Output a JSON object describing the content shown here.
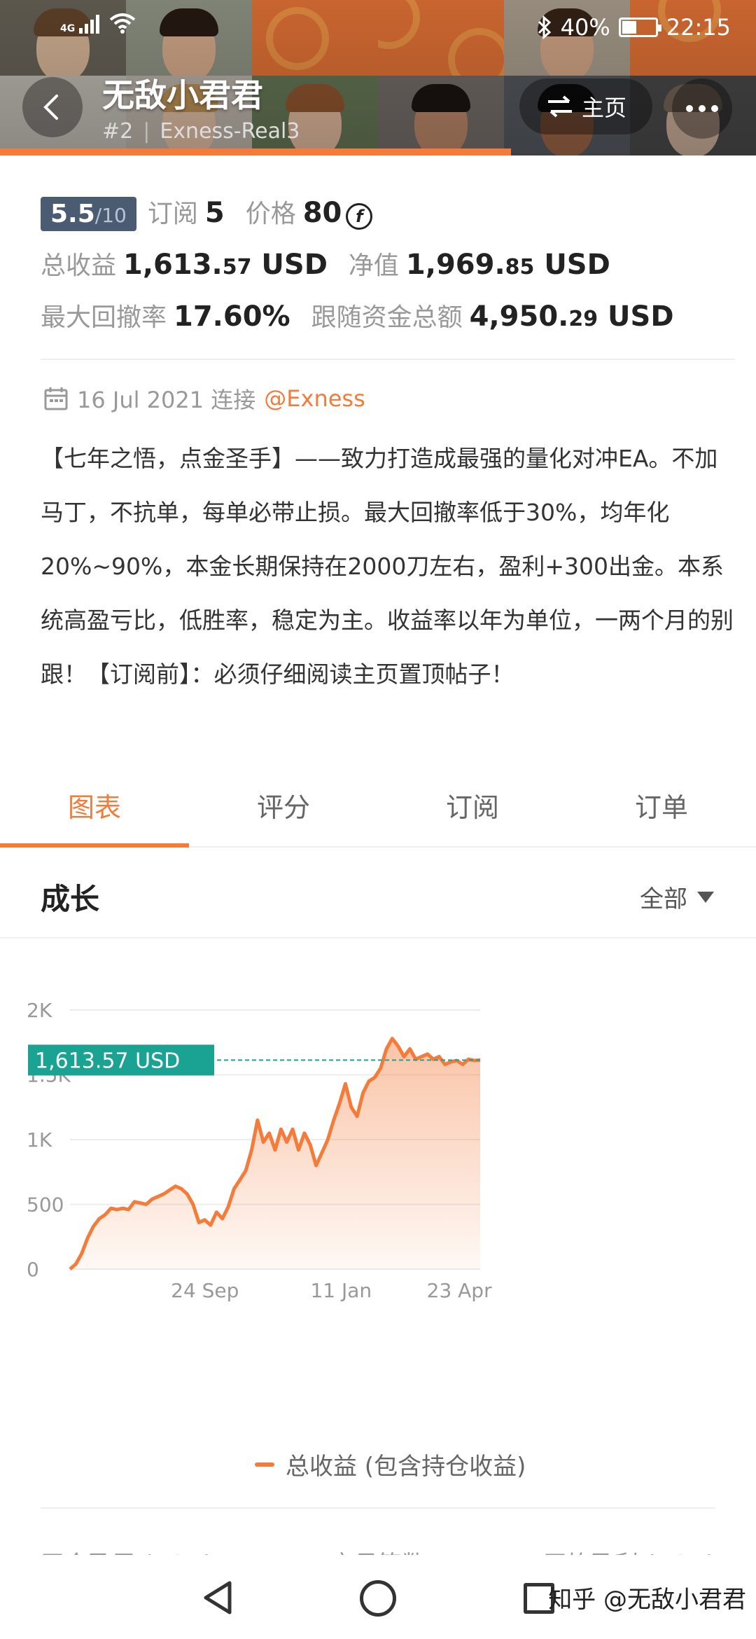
{
  "status_bar": {
    "network": "4G",
    "battery": "40%",
    "time": "22:15"
  },
  "header": {
    "name": "无敌小君君",
    "rank": "#2",
    "account": "Exness-Real3",
    "home_label": "主页"
  },
  "stats": {
    "rating_value": "5.5",
    "rating_max": "/10",
    "subscribe_label": "订阅",
    "subscribe_count": "5",
    "price_label": "价格",
    "price_value": "80",
    "total_profit_label": "总收益",
    "total_profit_main": "1,613.",
    "total_profit_dec": "57",
    "total_profit_unit": " USD",
    "equity_label": "净值",
    "equity_main": "1,969.",
    "equity_dec": "85",
    "equity_unit": " USD",
    "drawdown_label": "最大回撤率",
    "drawdown_value": "17.60%",
    "follow_label": "跟随资金总额",
    "follow_main": "4,950.",
    "follow_dec": "29",
    "follow_unit": " USD"
  },
  "meta": {
    "date": "16 Jul 2021 连接",
    "broker": "@Exness"
  },
  "description": "【七年之悟，点金圣手】——致力打造成最强的量化对冲EA。不加马丁，不抗单，每单必带止损。最大回撤率低于30%，均年化20%~90%，本金长期保持在2000刀左右，盈利+300出金。本系统高盈亏比，低胜率，稳定为主。收益率以年为单位，一两个月的别跟！【订阅前】：必须仔细阅读主页置顶帖子！",
  "tabs": [
    {
      "label": "图表",
      "active": true
    },
    {
      "label": "评分",
      "active": false
    },
    {
      "label": "订阅",
      "active": false
    },
    {
      "label": "订单",
      "active": false
    }
  ],
  "section": {
    "title": "成长",
    "range": "全部"
  },
  "chart_data": {
    "type": "area",
    "title": "成长",
    "series_name": "总收益 (包含持仓收益)",
    "current_label": "1,613.57 USD",
    "current_value": 1613.57,
    "ylim": [
      0,
      2000
    ],
    "yticks": [
      0,
      500,
      1000,
      1500,
      2000
    ],
    "ytick_labels": [
      "0",
      "500",
      "1K",
      "1.5K",
      "2K"
    ],
    "xtick_labels": [
      "24 Sep",
      "11 Jan",
      "23 Apr"
    ],
    "x": [
      "16 Jul",
      "20 Jul",
      "24 Jul",
      "28 Jul",
      "1 Aug",
      "5 Aug",
      "9 Aug",
      "13 Aug",
      "17 Aug",
      "21 Aug",
      "25 Aug",
      "29 Aug",
      "2 Sep",
      "6 Sep",
      "10 Sep",
      "14 Sep",
      "18 Sep",
      "22 Sep",
      "26 Sep",
      "30 Sep",
      "4 Oct",
      "8 Oct",
      "12 Oct",
      "16 Oct",
      "20 Oct",
      "24 Oct",
      "28 Oct",
      "1 Nov",
      "5 Nov",
      "9 Nov",
      "13 Nov",
      "17 Nov",
      "21 Nov",
      "25 Nov",
      "29 Nov",
      "3 Dec",
      "7 Dec",
      "11 Dec",
      "15 Dec",
      "19 Dec",
      "23 Dec",
      "27 Dec",
      "31 Dec",
      "4 Jan",
      "8 Jan",
      "12 Jan",
      "16 Jan",
      "20 Jan",
      "24 Jan",
      "28 Jan",
      "1 Feb",
      "5 Feb",
      "9 Feb",
      "13 Feb",
      "17 Feb",
      "21 Feb",
      "25 Feb",
      "1 Mar",
      "5 Mar",
      "9 Mar",
      "13 Mar",
      "17 Mar",
      "21 Mar",
      "25 Mar",
      "29 Mar",
      "2 Apr",
      "6 Apr",
      "10 Apr",
      "14 Apr",
      "18 Apr",
      "22 Apr",
      "26 Apr"
    ],
    "values": [
      0,
      40,
      120,
      240,
      330,
      390,
      420,
      470,
      460,
      470,
      460,
      520,
      510,
      500,
      540,
      560,
      580,
      610,
      640,
      620,
      580,
      500,
      360,
      380,
      340,
      440,
      390,
      480,
      620,
      690,
      760,
      920,
      1150,
      980,
      1050,
      920,
      1080,
      980,
      1080,
      920,
      1050,
      960,
      800,
      900,
      1000,
      1150,
      1280,
      1430,
      1250,
      1180,
      1360,
      1450,
      1480,
      1550,
      1700,
      1780,
      1720,
      1640,
      1700,
      1620,
      1640,
      1660,
      1620,
      1640,
      1580,
      1600,
      1610,
      1580,
      1620,
      1610,
      1613.57
    ]
  },
  "footer_peek": [
    "平仓盈亏 (USD)",
    "交易笔数",
    "平均盈利 (USD)"
  ],
  "watermark": "知乎 @无敌小君君"
}
